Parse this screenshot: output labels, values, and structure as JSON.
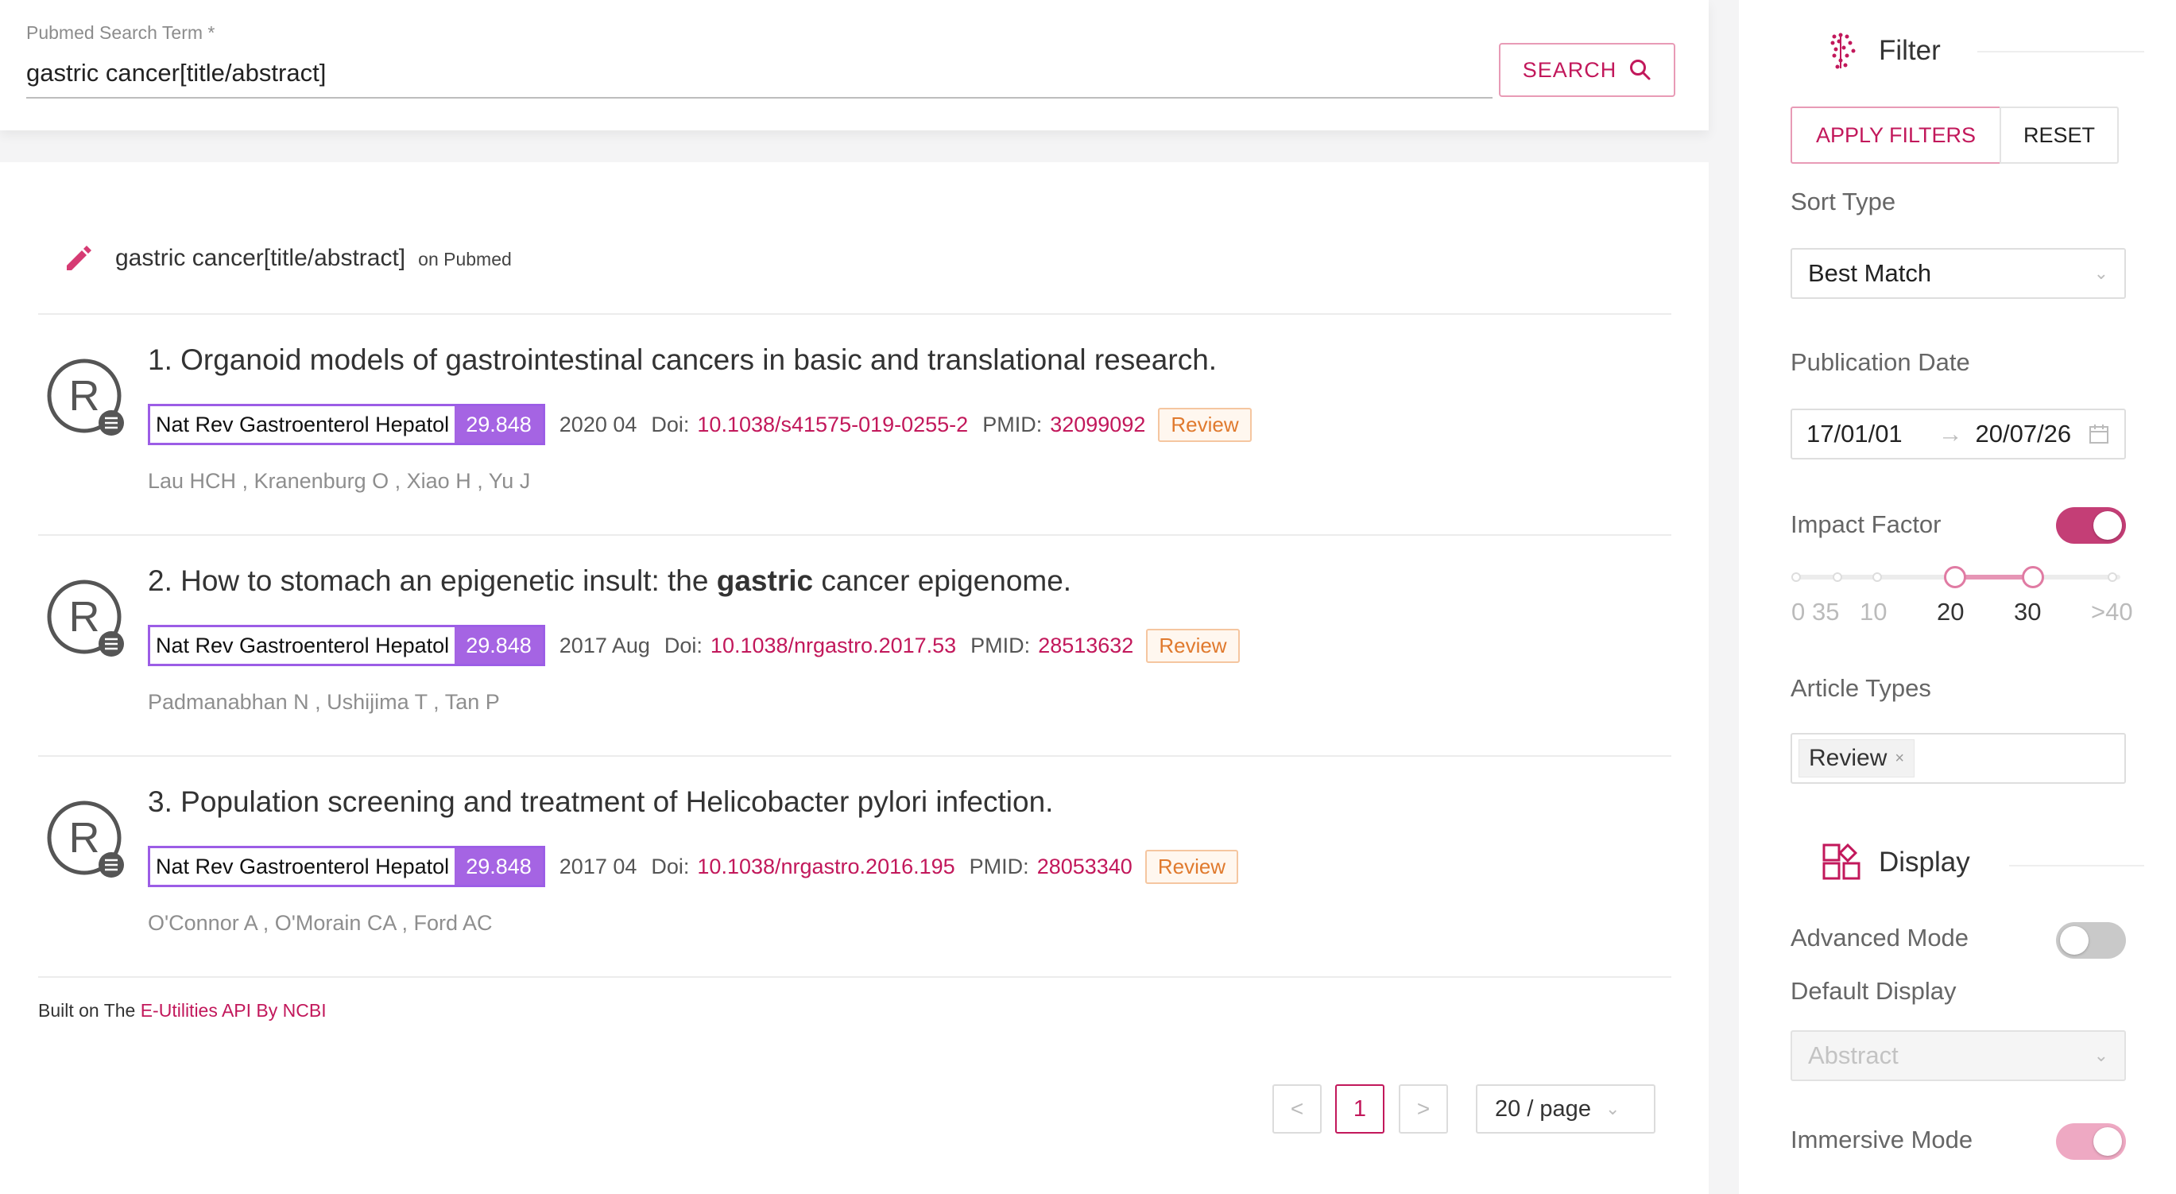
{
  "search": {
    "label": "Pubmed Search Term *",
    "value": "gastric cancer[title/abstract]",
    "button_label": "SEARCH"
  },
  "query": {
    "text": "gastric cancer[title/abstract]",
    "source": "on Pubmed"
  },
  "results": [
    {
      "title": "1. Organoid models of gastrointestinal cancers in basic and translational research.",
      "journal": "Nat Rev Gastroenterol Hepatol",
      "impact": "29.848",
      "date": "2020 04",
      "doi_label": "Doi:",
      "doi": "10.1038/s41575-019-0255-2",
      "pmid_label": "PMID:",
      "pmid": "32099092",
      "tag": "Review",
      "authors": "Lau HCH , Kranenburg O , Xiao H , Yu J"
    },
    {
      "title_pre": "2. How to stomach an epigenetic insult: the ",
      "title_bold": "gastric",
      "title_post": " cancer epigenome.",
      "journal": "Nat Rev Gastroenterol Hepatol",
      "impact": "29.848",
      "date": "2017 Aug",
      "doi_label": "Doi:",
      "doi": "10.1038/nrgastro.2017.53",
      "pmid_label": "PMID:",
      "pmid": "28513632",
      "tag": "Review",
      "authors": "Padmanabhan N , Ushijima T , Tan P"
    },
    {
      "title": "3. Population screening and treatment of Helicobacter pylori infection.",
      "journal": "Nat Rev Gastroenterol Hepatol",
      "impact": "29.848",
      "date": "2017 04",
      "doi_label": "Doi:",
      "doi": "10.1038/nrgastro.2016.195",
      "pmid_label": "PMID:",
      "pmid": "28053340",
      "tag": "Review",
      "authors": "O'Connor A , O'Morain CA , Ford AC"
    }
  ],
  "footer": {
    "prefix": "Built on The ",
    "link": "E-Utilities API By NCBI"
  },
  "pagination": {
    "prev": "<",
    "current": "1",
    "next": ">",
    "page_size": "20 / page"
  },
  "filter": {
    "title": "Filter",
    "apply_label": "APPLY FILTERS",
    "reset_label": "RESET",
    "sort_label": "Sort Type",
    "sort_value": "Best Match",
    "date_label": "Publication Date",
    "date_start": "17/01/01",
    "date_arrow": "→",
    "date_end": "20/07/26",
    "impact_label": "Impact Factor",
    "impact_enabled": true,
    "impact_marks": [
      "0",
      "35",
      "10",
      "20",
      "30",
      ">40"
    ],
    "impact_range": [
      20,
      30
    ],
    "article_types_label": "Article Types",
    "article_type_tag": "Review",
    "tag_close": "×"
  },
  "display": {
    "title": "Display",
    "advanced_label": "Advanced Mode",
    "advanced_enabled": false,
    "default_label": "Default Display",
    "default_value": "Abstract",
    "immersive_label": "Immersive Mode",
    "immersive_enabled": true
  },
  "colors": {
    "accent": "#c2185b",
    "impact_badge": "#a564e3",
    "review_tag": "#e07a2e"
  }
}
